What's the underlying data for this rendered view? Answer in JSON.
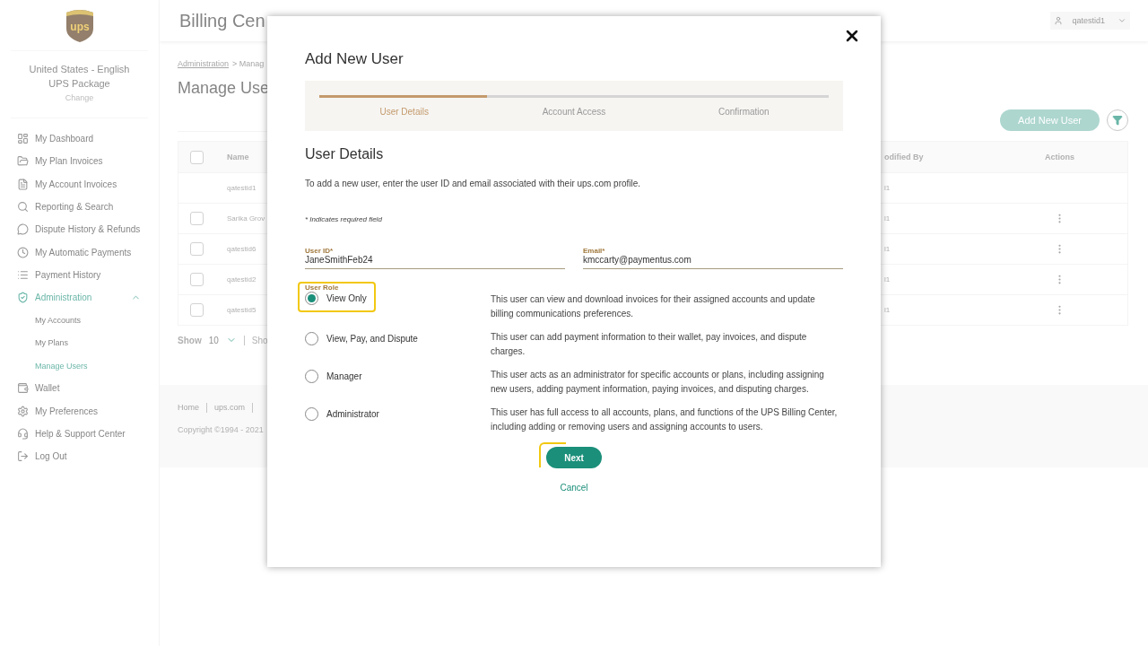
{
  "logo": {
    "text": "ups"
  },
  "locale": {
    "region": "United States - English",
    "service": "UPS Package",
    "change": "Change"
  },
  "sidebar": {
    "items": [
      {
        "label": "My Dashboard",
        "selected": false
      },
      {
        "label": "My Plan Invoices",
        "selected": false
      },
      {
        "label": "My Account Invoices",
        "selected": false
      },
      {
        "label": "Reporting & Search",
        "selected": false
      },
      {
        "label": "Dispute History & Refunds",
        "selected": false
      },
      {
        "label": "My Automatic Payments",
        "selected": false
      },
      {
        "label": "Payment History",
        "selected": false
      },
      {
        "label": "Administration",
        "selected": true,
        "expanded": true,
        "children": [
          {
            "label": "My Accounts",
            "selected": false
          },
          {
            "label": "My Plans",
            "selected": false
          },
          {
            "label": "Manage Users",
            "selected": true
          }
        ]
      },
      {
        "label": "Wallet",
        "selected": false
      },
      {
        "label": "My Preferences",
        "selected": false
      },
      {
        "label": "Help & Support Center",
        "selected": false
      },
      {
        "label": "Log Out",
        "selected": false
      }
    ]
  },
  "header": {
    "title": "Billing Cen",
    "user": "qatestid1"
  },
  "breadcrumb": {
    "link": "Administration",
    "rest": "> Manag"
  },
  "page_title": "Manage Use",
  "add_button": "Add New User",
  "table": {
    "columns": [
      "Name",
      "odified By",
      "Actions"
    ],
    "rows": [
      {
        "kind": "current",
        "name": "qatestid1",
        "modified_by": "l1"
      },
      {
        "kind": "user",
        "name": "Sarika Grov",
        "modified_by": "l1",
        "checked": false
      },
      {
        "kind": "user",
        "name": "qatestid6",
        "modified_by": "l1",
        "checked": false
      },
      {
        "kind": "user",
        "name": "qatestid2",
        "modified_by": "l1",
        "checked": false
      },
      {
        "kind": "user",
        "name": "qatestid5",
        "modified_by": "l1",
        "checked": false
      }
    ],
    "select_all": {
      "checked": false
    }
  },
  "pager": {
    "label": "Show",
    "value": "10",
    "rest": "Sho"
  },
  "footer": {
    "links": [
      "Home",
      "ups.com"
    ],
    "copyright": "Copyright ©1994 - 2021"
  },
  "modal": {
    "title": "Add New User",
    "steps": [
      {
        "label": "User Details",
        "selected": true
      },
      {
        "label": "Account Access",
        "selected": false
      },
      {
        "label": "Confirmation",
        "selected": false
      }
    ],
    "progress": {
      "level": 0.33
    },
    "section_title": "User Details",
    "intro": "To add a new user, enter the user ID and email associated with their ups.com profile.",
    "required_note": "* Indicates required field",
    "fields": [
      {
        "label": "User ID*",
        "value": "JaneSmithFeb24"
      },
      {
        "label": "Email*",
        "value": "kmccarty@paymentus.com"
      }
    ],
    "role_label": "User Role",
    "roles": [
      {
        "label": "View Only",
        "selected": true,
        "focused": true,
        "description": "This user can view and download invoices for their assigned accounts and update billing communications preferences."
      },
      {
        "label": "View, Pay, and Dispute",
        "selected": false,
        "focused": false,
        "description": "This user can add payment information to their wallet, pay invoices, and dispute charges."
      },
      {
        "label": "Manager",
        "selected": false,
        "focused": false,
        "description": "This user acts as an administrator for specific accounts or plans, including assigning new users, adding payment information, paying invoices, and disputing charges."
      },
      {
        "label": "Administrator",
        "selected": false,
        "focused": false,
        "description": "This user has full access to all accounts, plans, and functions of the UPS Billing Center, including adding or removing users and assigning accounts to users."
      }
    ],
    "next": "Next",
    "cancel": "Cancel"
  }
}
